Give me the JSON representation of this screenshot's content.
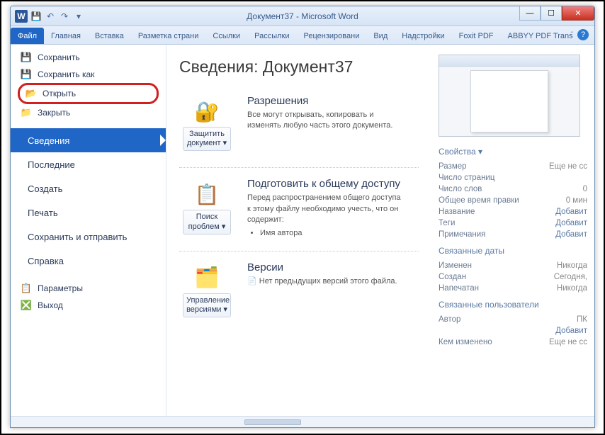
{
  "titlebar": {
    "title": "Документ37 - Microsoft Word",
    "app_letter": "W"
  },
  "ribbon_tabs": [
    "Файл",
    "Главная",
    "Вставка",
    "Разметка страни",
    "Ссылки",
    "Рассылки",
    "Рецензировани",
    "Вид",
    "Надстройки",
    "Foxit PDF",
    "ABBYY PDF Trans"
  ],
  "left_menu": {
    "save": "Сохранить",
    "save_as": "Сохранить как",
    "open": "Открыть",
    "close": "Закрыть",
    "info": "Сведения",
    "recent": "Последние",
    "new": "Создать",
    "print": "Печать",
    "share": "Сохранить и отправить",
    "help": "Справка",
    "options": "Параметры",
    "exit": "Выход"
  },
  "main": {
    "heading": "Сведения: Документ37",
    "permissions": {
      "button": "Защитить документ",
      "title": "Разрешения",
      "body": "Все могут открывать, копировать и изменять любую часть этого документа."
    },
    "prepare": {
      "button": "Поиск проблем",
      "title": "Подготовить к общему доступу",
      "body": "Перед распространением общего доступа к этому файлу необходимо учесть, что он содержит:",
      "bullet": "Имя автора"
    },
    "versions": {
      "button": "Управление версиями",
      "title": "Версии",
      "body": "Нет предыдущих версий этого файла."
    }
  },
  "props": {
    "head1": "Свойства",
    "size_k": "Размер",
    "size_v": "Еще не сс",
    "pages_k": "Число страниц",
    "words_k": "Число слов",
    "words_v": "0",
    "edit_k": "Общее время правки",
    "edit_v": "0 мин",
    "title_k": "Название",
    "title_v": "Добавит",
    "tags_k": "Теги",
    "tags_v": "Добавит",
    "comments_k": "Примечания",
    "comments_v": "Добавит",
    "head2": "Связанные даты",
    "modified_k": "Изменен",
    "modified_v": "Никогда",
    "created_k": "Создан",
    "created_v": "Сегодня,",
    "printed_k": "Напечатан",
    "printed_v": "Никогда",
    "head3": "Связанные пользователи",
    "author_k": "Автор",
    "author_v": "ПК",
    "add_author": "Добавит",
    "lastmod_k": "Кем изменено",
    "lastmod_v": "Еще не сс"
  }
}
